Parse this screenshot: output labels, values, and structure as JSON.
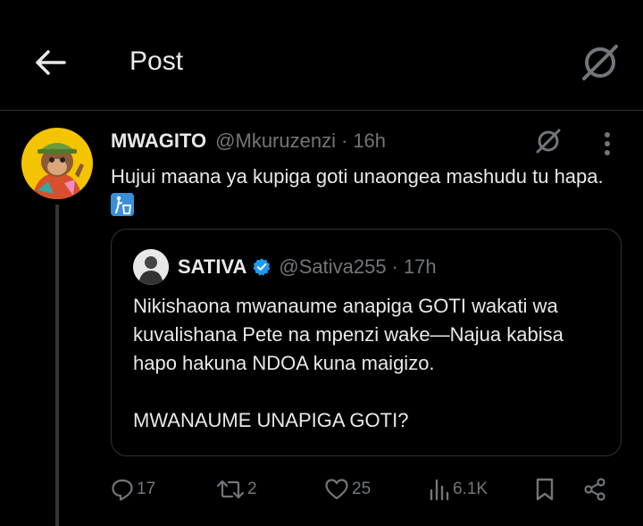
{
  "header": {
    "title": "Post",
    "back_icon": "arrow-left-icon",
    "grok_icon": "grok-icon"
  },
  "post": {
    "author_name": "MWAGITO",
    "author_handle": "@Mkuruzenzi",
    "separator": "·",
    "time": "16h",
    "text": "Hujui maana ya kupiga goti unaongea mashudu tu hapa.",
    "emoji": "put-litter-in-its-place-emoji",
    "avatar": "ape-nft-avatar"
  },
  "quote": {
    "author_name": "SATIVA",
    "author_handle": "@Sativa255",
    "separator": "·",
    "time": "17h",
    "verified": true,
    "text": "Nikishaona mwanaume anapiga GOTI wakati wa kuvalishana Pete na mpenzi wake—Najua kabisa hapo hakuna NDOA kuna maigizo.\n\nMWANAUME UNAPIGA GOTI?"
  },
  "actions": {
    "replies": "17",
    "reposts": "2",
    "likes": "25",
    "views": "6.1K"
  },
  "colors": {
    "background": "#000000",
    "text": "#e7e9ea",
    "muted": "#71767b",
    "border": "#2f3336",
    "verified": "#1d9bf0"
  }
}
